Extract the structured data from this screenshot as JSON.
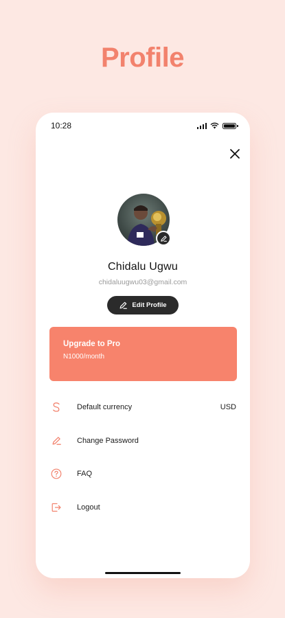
{
  "header": {
    "title": "Profile"
  },
  "status_bar": {
    "time": "10:28"
  },
  "profile": {
    "name": "Chidalu Ugwu",
    "email": "chidaluugwu03@gmail.com",
    "edit_label": "Edit Profile"
  },
  "pro_card": {
    "title": "Upgrade to Pro",
    "price": "N1000/month"
  },
  "menu": {
    "items": [
      {
        "icon": "dollar-icon",
        "label": "Default currency",
        "value": "USD"
      },
      {
        "icon": "pencil-icon",
        "label": "Change Password"
      },
      {
        "icon": "question-circle-icon",
        "label": "FAQ"
      },
      {
        "icon": "logout-icon",
        "label": "Logout"
      }
    ]
  },
  "colors": {
    "background": "#fde8e3",
    "accent": "#f7836c",
    "dark_button": "#2b2b2b"
  }
}
